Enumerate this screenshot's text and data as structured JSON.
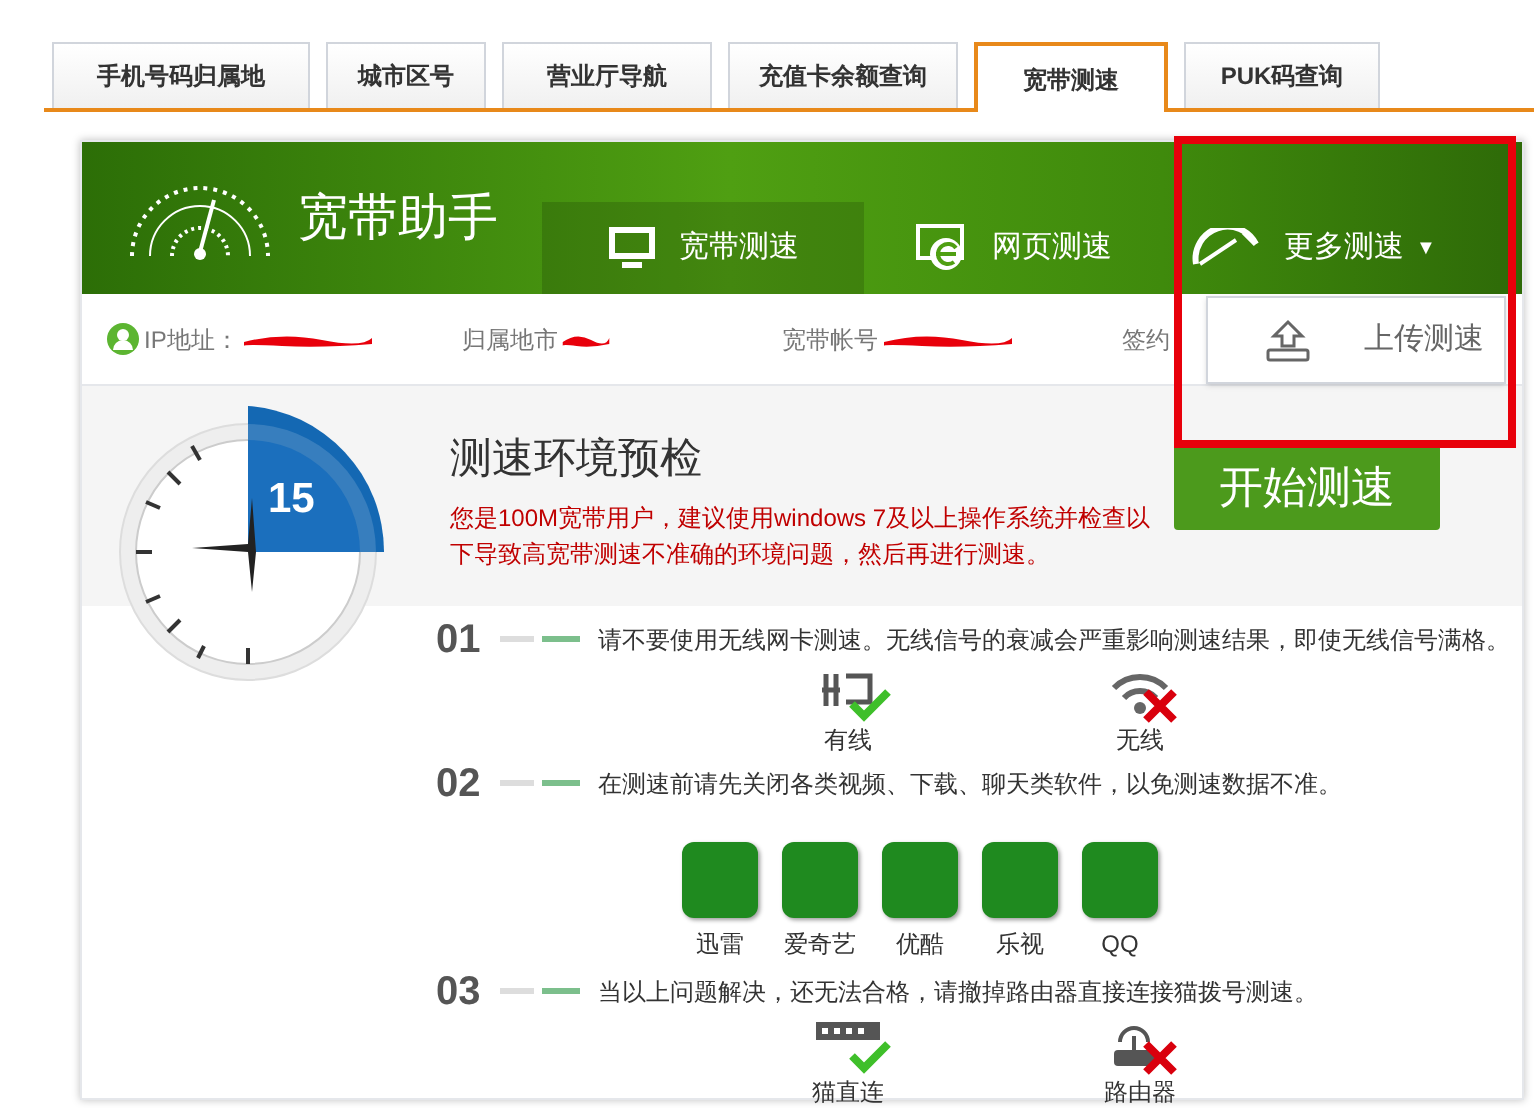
{
  "tabs": [
    {
      "label": "手机号码归属地",
      "selected": false
    },
    {
      "label": "城市区号",
      "selected": false
    },
    {
      "label": "营业厅导航",
      "selected": false
    },
    {
      "label": "充值卡余额查询",
      "selected": false
    },
    {
      "label": "宽带测速",
      "selected": true
    },
    {
      "label": "PUK码查询",
      "selected": false
    }
  ],
  "header": {
    "title": "宽带助手",
    "nav": [
      {
        "label": "宽带测速",
        "selected": true
      },
      {
        "label": "网页测速",
        "selected": false
      },
      {
        "label": "更多测速",
        "selected": false,
        "dropdown": "▼"
      }
    ],
    "dropdown_items": [
      "上传测速"
    ]
  },
  "info_row": [
    {
      "label": "IP地址："
    },
    {
      "label": "归属地市"
    },
    {
      "label": "宽带帐号"
    },
    {
      "label": "签约"
    }
  ],
  "precheck": {
    "timer": "15",
    "title": "测速环境预检",
    "notice": "您是100M宽带用户，建议使用windows 7及以上操作系统并检查以下导致高宽带测速不准确的环境问题，然后再进行测速。",
    "start_button": "开始测速"
  },
  "steps": [
    {
      "number": "01",
      "text": "请不要使用无线网卡测速。无线信号的衰减会严重影响测速结果，即使无线信号满格。",
      "items": [
        {
          "label": "有线",
          "kind": "allowed"
        },
        {
          "label": "无线",
          "kind": "blocked"
        }
      ]
    },
    {
      "number": "02",
      "text": "在测速前请先关闭各类视频、下载、聊天类软件，以免测速数据不准。",
      "apps": [
        "迅雷",
        "爱奇艺",
        "优酷",
        "乐视",
        "QQ"
      ]
    },
    {
      "number": "03",
      "text": "当以上问题解决，还无法合格，请撤掉路由器直接连接猫拨号测速。",
      "items": [
        {
          "label": "猫直连",
          "kind": "allowed"
        },
        {
          "label": "路由器",
          "kind": "blocked"
        }
      ]
    }
  ]
}
